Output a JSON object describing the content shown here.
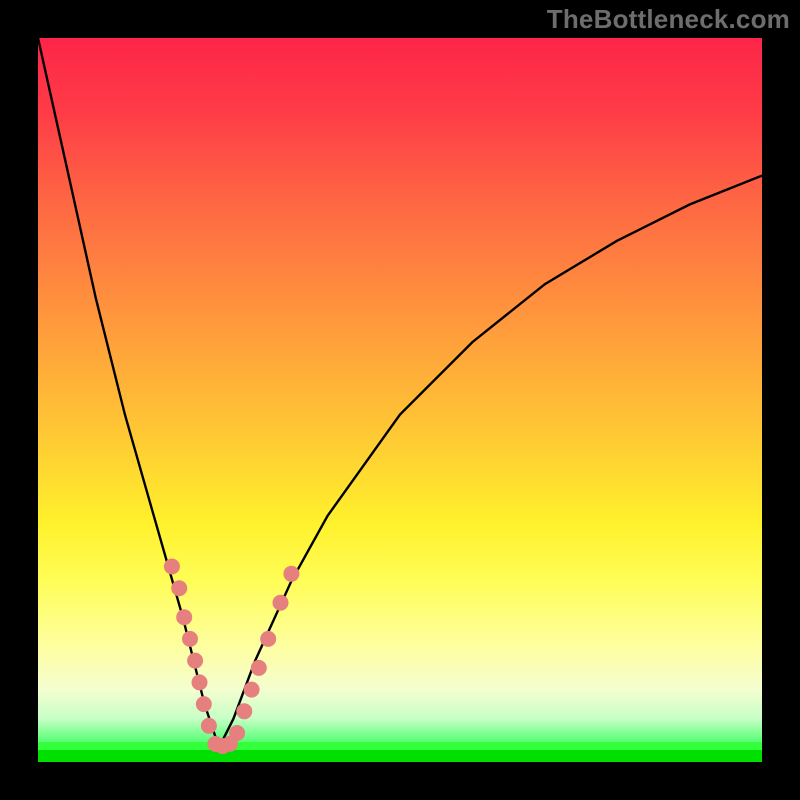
{
  "watermark": "TheBottleneck.com",
  "chart_data": {
    "type": "line",
    "title": "",
    "xlabel": "",
    "ylabel": "",
    "xlim": [
      0,
      100
    ],
    "ylim": [
      0,
      100
    ],
    "background_gradient_meaning": "bottleneck severity (red=high, green=low)",
    "curve": {
      "name": "bottleneck-curve",
      "description": "V-shaped bottleneck curve; minimum near x≈25",
      "x": [
        0,
        4,
        8,
        12,
        16,
        20,
        23,
        25,
        27,
        30,
        35,
        40,
        50,
        60,
        70,
        80,
        90,
        100
      ],
      "y": [
        100,
        82,
        64,
        48,
        34,
        20,
        8,
        2,
        6,
        14,
        25,
        34,
        48,
        58,
        66,
        72,
        77,
        81
      ]
    },
    "highlight_dots": {
      "name": "highlighted-points",
      "color": "#e6807e",
      "radius_px": 8,
      "points": [
        {
          "x": 18.5,
          "y": 27
        },
        {
          "x": 19.5,
          "y": 24
        },
        {
          "x": 20.2,
          "y": 20
        },
        {
          "x": 21.0,
          "y": 17
        },
        {
          "x": 21.7,
          "y": 14
        },
        {
          "x": 22.3,
          "y": 11
        },
        {
          "x": 22.9,
          "y": 8
        },
        {
          "x": 23.6,
          "y": 5
        },
        {
          "x": 24.5,
          "y": 2.5
        },
        {
          "x": 25.5,
          "y": 2.2
        },
        {
          "x": 26.5,
          "y": 2.5
        },
        {
          "x": 27.5,
          "y": 4
        },
        {
          "x": 28.5,
          "y": 7
        },
        {
          "x": 29.5,
          "y": 10
        },
        {
          "x": 30.5,
          "y": 13
        },
        {
          "x": 31.8,
          "y": 17
        },
        {
          "x": 33.5,
          "y": 22
        },
        {
          "x": 35.0,
          "y": 26
        }
      ]
    }
  }
}
